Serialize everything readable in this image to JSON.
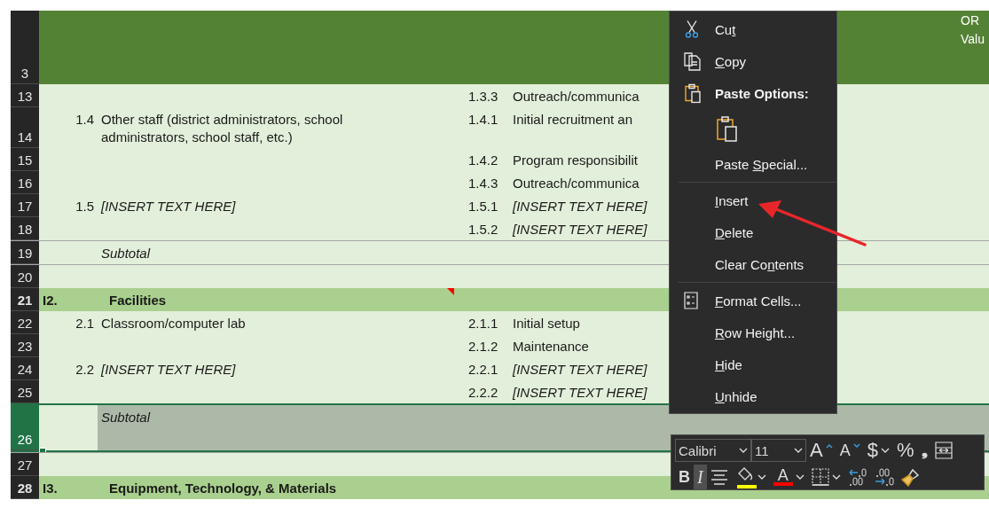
{
  "header_row": {
    "row_number": "3",
    "selected": false,
    "column_text": [
      "OR",
      "Valu"
    ]
  },
  "rows": [
    {
      "row_number": "13",
      "kind": "item",
      "selected": false,
      "has_comment": false,
      "sub_number": "1.3.3",
      "sub_text": "Outreach/communica",
      "sub_italic": false
    },
    {
      "row_number": "14",
      "kind": "item",
      "selected": false,
      "has_comment": false,
      "number": "1.4",
      "text": "Other staff (district administrators, school administrators, school staff, etc.)",
      "text_italic": false,
      "sub_number": "1.4.1",
      "sub_text": "Initial recruitment an",
      "sub_italic": false
    },
    {
      "row_number": "15",
      "kind": "item",
      "selected": false,
      "has_comment": false,
      "sub_number": "1.4.2",
      "sub_text": "Program responsibilit",
      "sub_italic": false
    },
    {
      "row_number": "16",
      "kind": "item",
      "selected": false,
      "has_comment": false,
      "sub_number": "1.4.3",
      "sub_text": "Outreach/communica",
      "sub_italic": false
    },
    {
      "row_number": "17",
      "kind": "item",
      "selected": false,
      "has_comment": false,
      "number": "1.5",
      "text": "[INSERT TEXT HERE]",
      "text_italic": true,
      "sub_number": "1.5.1",
      "sub_text": "[INSERT TEXT HERE]",
      "sub_italic": true
    },
    {
      "row_number": "18",
      "kind": "item",
      "selected": false,
      "has_comment": false,
      "sub_number": "1.5.2",
      "sub_text": "[INSERT TEXT HERE]",
      "sub_italic": true
    },
    {
      "row_number": "19",
      "kind": "subtotal",
      "selected": false,
      "has_comment": false,
      "text": "Subtotal",
      "text_italic": true
    },
    {
      "row_number": "20",
      "kind": "blank",
      "selected": false,
      "has_comment": false
    },
    {
      "row_number": "21",
      "kind": "section",
      "selected": false,
      "has_comment": true,
      "code": "I2.",
      "text": "Facilities",
      "text_italic": false
    },
    {
      "row_number": "22",
      "kind": "item",
      "selected": false,
      "has_comment": false,
      "number": "2.1",
      "text": "Classroom/computer lab",
      "text_italic": false,
      "sub_number": "2.1.1",
      "sub_text": "Initial setup",
      "sub_italic": false
    },
    {
      "row_number": "23",
      "kind": "item",
      "selected": false,
      "has_comment": false,
      "sub_number": "2.1.2",
      "sub_text": "Maintenance",
      "sub_italic": false
    },
    {
      "row_number": "24",
      "kind": "item",
      "selected": false,
      "has_comment": false,
      "number": "2.2",
      "text": "[INSERT TEXT HERE]",
      "text_italic": true,
      "sub_number": "2.2.1",
      "sub_text": "[INSERT TEXT HERE]",
      "sub_italic": true
    },
    {
      "row_number": "25",
      "kind": "item",
      "selected": false,
      "has_comment": false,
      "sub_number": "2.2.2",
      "sub_text": "[INSERT TEXT HERE]",
      "sub_italic": true
    },
    {
      "row_number": "26",
      "kind": "subtotal",
      "selected": true,
      "has_comment": false,
      "text": "Subtotal",
      "text_italic": true
    },
    {
      "row_number": "27",
      "kind": "blank",
      "selected": false,
      "has_comment": false
    },
    {
      "row_number": "28",
      "kind": "section",
      "selected": false,
      "has_comment": false,
      "code": "I3.",
      "text": "Equipment, Technology, & Materials",
      "text_italic": false
    }
  ],
  "context_menu": [
    {
      "kind": "cut",
      "label": {
        "before": "Cu",
        "key": "t"
      }
    },
    {
      "kind": "copy",
      "label": {
        "key": "C",
        "after": "opy"
      }
    },
    {
      "kind": "paste-header",
      "label": {
        "before": "Paste Options:"
      }
    },
    {
      "kind": "paste-button"
    },
    {
      "kind": "plain",
      "label": {
        "before": "Paste ",
        "key": "S",
        "after": "pecial..."
      }
    },
    {
      "kind": "separator"
    },
    {
      "kind": "plain",
      "label": {
        "key": "I",
        "after": "nsert"
      }
    },
    {
      "kind": "plain",
      "label": {
        "key": "D",
        "after": "elete"
      }
    },
    {
      "kind": "plain",
      "label": {
        "before": "Clear Co",
        "key": "n",
        "after": "tents"
      }
    },
    {
      "kind": "separator"
    },
    {
      "kind": "format",
      "label": {
        "key": "F",
        "after": "ormat Cells..."
      }
    },
    {
      "kind": "plain",
      "label": {
        "key": "R",
        "after": "ow Height..."
      }
    },
    {
      "kind": "plain",
      "label": {
        "key": "H",
        "after": "ide"
      }
    },
    {
      "kind": "plain",
      "label": {
        "key": "U",
        "after": "nhide"
      }
    }
  ],
  "mini_toolbar": {
    "font": "Calibri",
    "size": "11",
    "row_1": [
      {
        "kind": "grow-font",
        "label": "A",
        "pressed": false,
        "has_dropdown": false
      },
      {
        "kind": "shrink-font",
        "label": "A",
        "pressed": false,
        "has_dropdown": false
      },
      {
        "kind": "text",
        "label": "$",
        "pressed": false,
        "has_dropdown": true
      },
      {
        "kind": "text",
        "label": "%",
        "pressed": false,
        "has_dropdown": false
      },
      {
        "kind": "comma",
        "label": "❟",
        "pressed": false,
        "has_dropdown": false
      },
      {
        "kind": "merge",
        "pressed": false,
        "has_dropdown": false
      }
    ],
    "row_2": [
      {
        "kind": "bold",
        "label": "B",
        "pressed": false,
        "has_dropdown": false
      },
      {
        "kind": "italic",
        "label": "I",
        "pressed": true,
        "has_dropdown": false
      },
      {
        "kind": "align",
        "pressed": false,
        "has_dropdown": false
      },
      {
        "kind": "fill",
        "pressed": false,
        "has_dropdown": true,
        "color": "#ffff00"
      },
      {
        "kind": "font-color",
        "label": "A",
        "pressed": false,
        "has_dropdown": true,
        "color": "#ff0000"
      },
      {
        "kind": "borders",
        "pressed": false,
        "has_dropdown": true
      },
      {
        "kind": "decimal",
        "pressed": false,
        "has_dropdown": false
      },
      {
        "kind": "decimal-more",
        "pressed": false,
        "has_dropdown": false
      },
      {
        "kind": "painter",
        "pressed": false,
        "has_dropdown": false
      }
    ]
  }
}
